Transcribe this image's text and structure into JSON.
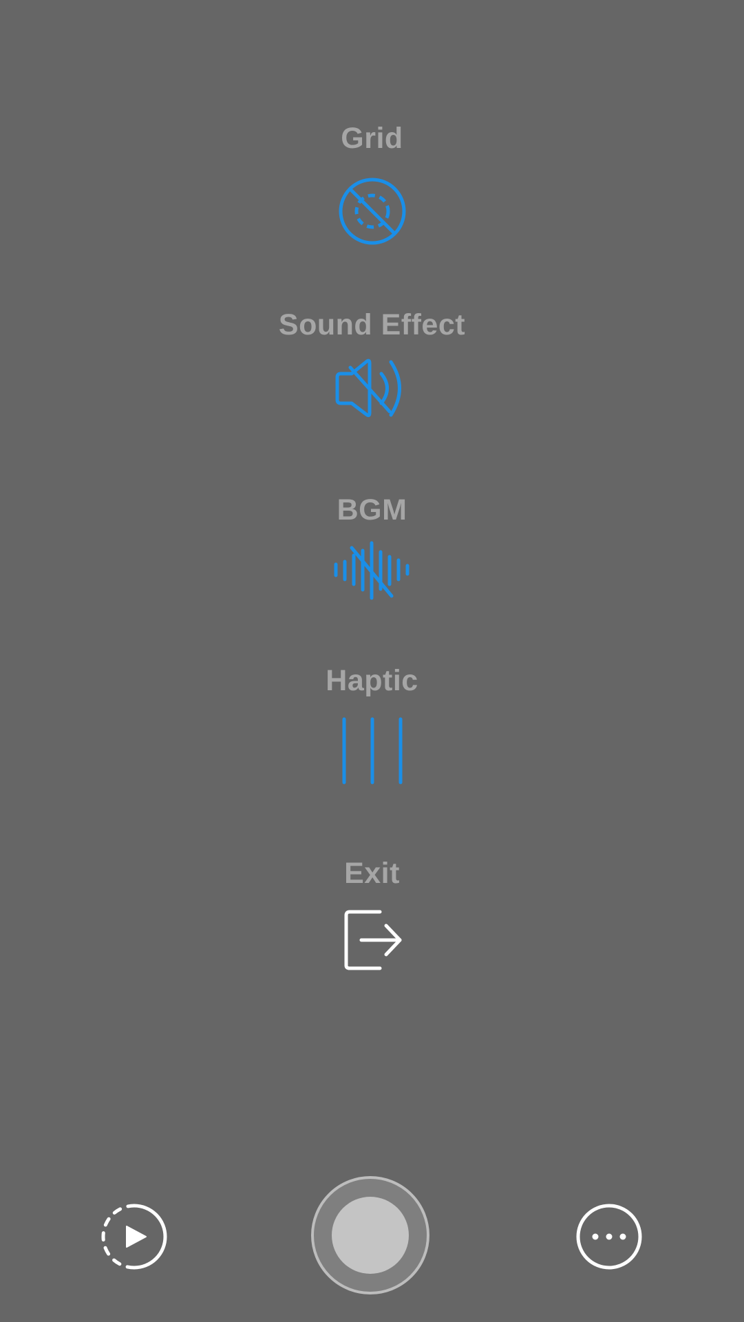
{
  "menu": {
    "grid": {
      "label": "Grid",
      "icon": "grid-off-icon",
      "state": "off"
    },
    "sound_effect": {
      "label": "Sound Effect",
      "icon": "speaker-muted-icon",
      "state": "off"
    },
    "bgm": {
      "label": "BGM",
      "icon": "waveform-muted-icon",
      "state": "off"
    },
    "haptic": {
      "label": "Haptic",
      "icon": "haptic-bars-icon",
      "state": "on"
    },
    "exit": {
      "label": "Exit",
      "icon": "exit-arrow-icon"
    }
  },
  "toolbar": {
    "left_icon": "replay-dashed-play-icon",
    "center_icon": "shutter-button",
    "right_icon": "more-dots-icon"
  },
  "colors": {
    "background": "#666666",
    "label": "#a6a6a6",
    "accent": "#1a8fe8",
    "white": "#ffffff",
    "shutter_inner": "#c4c4c4",
    "shutter_ring": "#7f7f7f"
  }
}
